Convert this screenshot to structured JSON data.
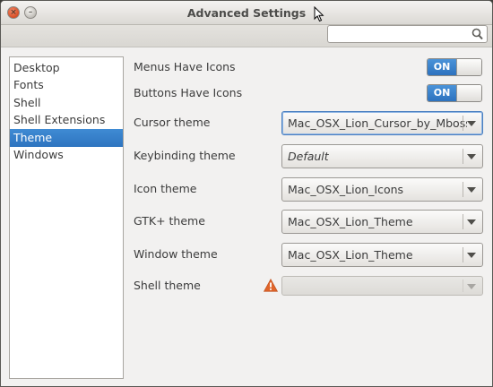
{
  "window": {
    "title": "Advanced Settings"
  },
  "search": {
    "value": "",
    "placeholder": ""
  },
  "sidebar": {
    "items": [
      {
        "label": "Desktop"
      },
      {
        "label": "Fonts"
      },
      {
        "label": "Shell"
      },
      {
        "label": "Shell Extensions"
      },
      {
        "label": "Theme",
        "selected": true
      },
      {
        "label": "Windows"
      }
    ]
  },
  "settings": {
    "menus_have_icons": {
      "label": "Menus Have Icons",
      "state": "ON"
    },
    "buttons_have_icons": {
      "label": "Buttons Have Icons",
      "state": "ON"
    },
    "cursor_theme": {
      "label": "Cursor theme",
      "value": "Mac_OSX_Lion_Cursor_by_Mboss"
    },
    "keybinding_theme": {
      "label": "Keybinding theme",
      "value": "Default"
    },
    "icon_theme": {
      "label": "Icon theme",
      "value": "Mac_OSX_Lion_Icons"
    },
    "gtk_theme": {
      "label": "GTK+ theme",
      "value": "Mac_OSX_Lion_Theme"
    },
    "window_theme": {
      "label": "Window theme",
      "value": "Mac_OSX_Lion_Theme"
    },
    "shell_theme": {
      "label": "Shell theme",
      "value": ""
    }
  },
  "colors": {
    "selection": "#2e74c0",
    "toggle_on": "#3a86d0",
    "warning": "#e0652a"
  },
  "icons": {
    "search": "search-icon",
    "warning": "warning-icon",
    "close": "close-icon",
    "minimize": "minimize-icon",
    "dropdown": "chevron-down-icon"
  }
}
